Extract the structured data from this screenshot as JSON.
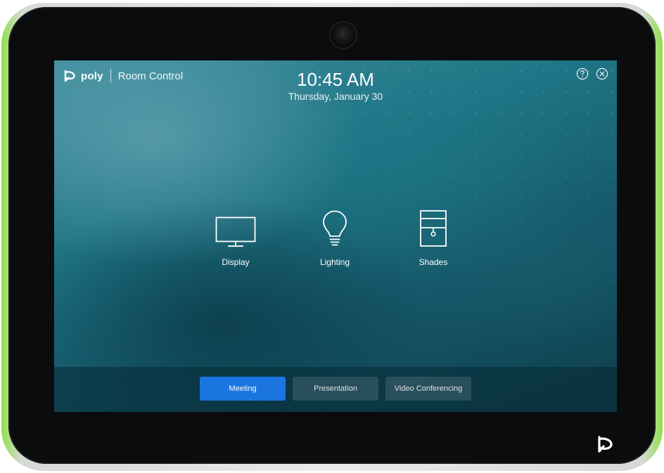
{
  "header": {
    "brand": "poly",
    "app_title": "Room Control",
    "time": "10:45 AM",
    "date": "Thursday, January 30",
    "help_icon": "help-circle-icon",
    "close_icon": "close-circle-icon"
  },
  "tiles": [
    {
      "label": "Display",
      "icon": "monitor-icon"
    },
    {
      "label": "Lighting",
      "icon": "lightbulb-icon"
    },
    {
      "label": "Shades",
      "icon": "shades-icon"
    }
  ],
  "modes": [
    {
      "label": "Meeting",
      "active": true
    },
    {
      "label": "Presentation",
      "active": false
    },
    {
      "label": "Video Conferencing",
      "active": false
    }
  ],
  "colors": {
    "accent": "#1a75e0",
    "bezel": "#0b0c0d",
    "status_light": "#8ee04a"
  }
}
